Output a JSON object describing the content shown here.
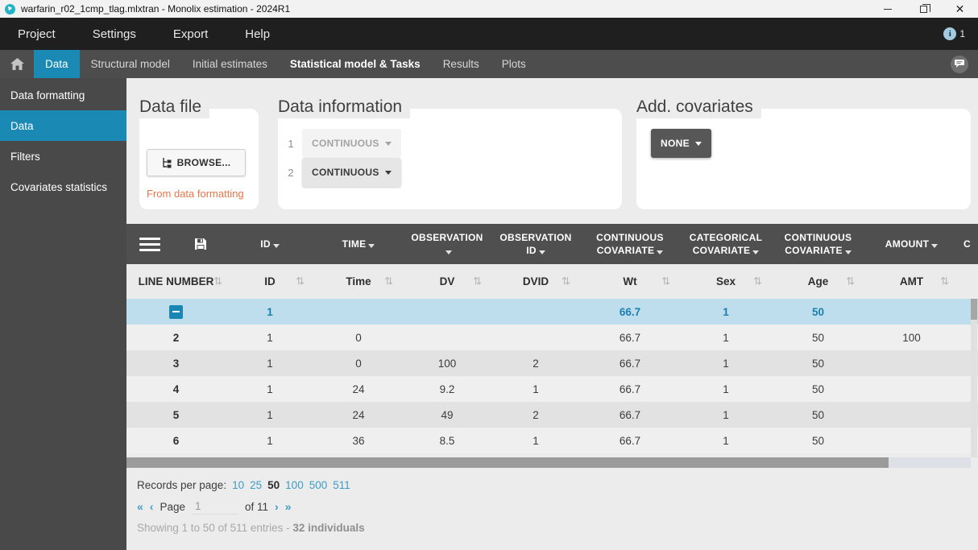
{
  "window": {
    "title": "warfarin_r02_1cmp_tlag.mlxtran - Monolix estimation - 2024R1"
  },
  "menubar": {
    "items": [
      "Project",
      "Settings",
      "Export",
      "Help"
    ],
    "notification_count": "1"
  },
  "tabbar": {
    "tabs": [
      "Data",
      "Structural model",
      "Initial estimates",
      "Statistical model & Tasks",
      "Results",
      "Plots"
    ],
    "active_tab": "Data",
    "emphasized_tab": "Statistical model & Tasks"
  },
  "sidebar": {
    "items": [
      "Data formatting",
      "Data",
      "Filters",
      "Covariates statistics"
    ],
    "active_item": "Data"
  },
  "panels": {
    "data_file": {
      "title": "Data file",
      "browse_label": "BROWSE...",
      "link": "From data formatting"
    },
    "data_information": {
      "title": "Data information",
      "rows": [
        {
          "index": "1",
          "value": "CONTINUOUS",
          "disabled": true
        },
        {
          "index": "2",
          "value": "CONTINUOUS",
          "disabled": false
        }
      ]
    },
    "add_covariates": {
      "title": "Add. covariates",
      "value": "NONE"
    }
  },
  "table": {
    "type_headers": [
      "ID",
      "TIME",
      "OBSERVATION",
      "OBSERVATION ID",
      "CONTINUOUS COVARIATE",
      "CATEGORICAL COVARIATE",
      "CONTINUOUS COVARIATE",
      "AMOUNT",
      "C"
    ],
    "column_headers": [
      "LINE NUMBER",
      "ID",
      "Time",
      "DV",
      "DVID",
      "Wt",
      "Sex",
      "Age",
      "AMT"
    ],
    "rows": [
      {
        "line": "",
        "id": "1",
        "time": "",
        "dv": "",
        "dvid": "",
        "wt": "66.7",
        "sex": "1",
        "age": "50",
        "amt": "",
        "selected": true
      },
      {
        "line": "2",
        "id": "1",
        "time": "0",
        "dv": "",
        "dvid": "",
        "wt": "66.7",
        "sex": "1",
        "age": "50",
        "amt": "100"
      },
      {
        "line": "3",
        "id": "1",
        "time": "0",
        "dv": "100",
        "dvid": "2",
        "wt": "66.7",
        "sex": "1",
        "age": "50",
        "amt": ""
      },
      {
        "line": "4",
        "id": "1",
        "time": "24",
        "dv": "9.2",
        "dvid": "1",
        "wt": "66.7",
        "sex": "1",
        "age": "50",
        "amt": ""
      },
      {
        "line": "5",
        "id": "1",
        "time": "24",
        "dv": "49",
        "dvid": "2",
        "wt": "66.7",
        "sex": "1",
        "age": "50",
        "amt": ""
      },
      {
        "line": "6",
        "id": "1",
        "time": "36",
        "dv": "8.5",
        "dvid": "1",
        "wt": "66.7",
        "sex": "1",
        "age": "50",
        "amt": ""
      }
    ]
  },
  "pagination": {
    "records_label": "Records per page:",
    "options": [
      "10",
      "25",
      "50",
      "100",
      "500",
      "511"
    ],
    "selected_option": "50",
    "first": "«",
    "prev": "‹",
    "page_label": "Page",
    "page_value": "1",
    "of_label": "of 11",
    "next": "›",
    "last": "»",
    "summary": "Showing 1 to 50 of 511 entries - ",
    "summary_bold": "32 individuals"
  },
  "colors": {
    "accent_blue": "#1a8ab5",
    "selected_row_bg": "#bedded",
    "link_blue": "#3e9dc6",
    "orange_link": "#e8764b"
  }
}
